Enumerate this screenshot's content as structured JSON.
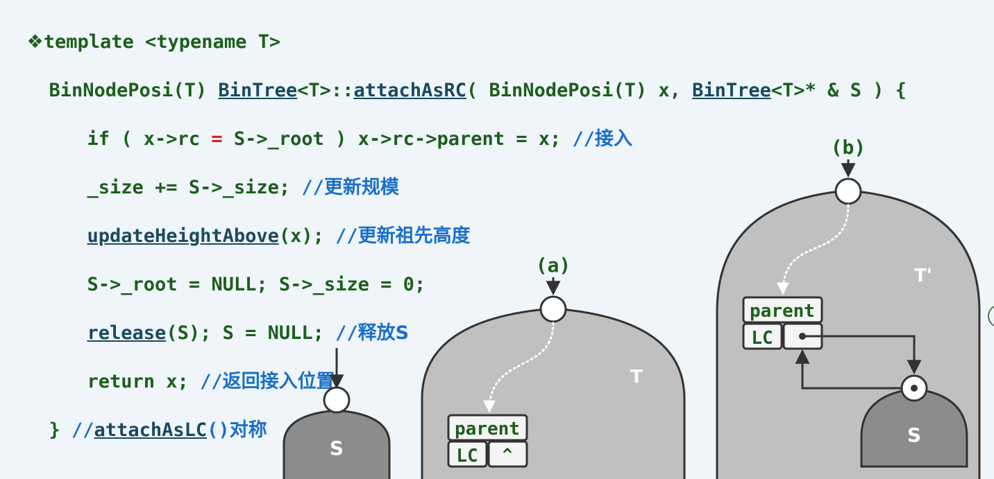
{
  "code": {
    "line1_bullet": "❖",
    "line1": "template <typename T>",
    "line2_a": "BinNodePosi(T) ",
    "line2_b": "BinTree",
    "line2_c": "<T>::",
    "line2_d": "attachAsRC",
    "line2_e": "( BinNodePosi(T) x, ",
    "line2_f": "BinTree",
    "line2_g": "<T>* & S ) {",
    "line3_a": "if ( x->rc ",
    "line3_eq": "=",
    "line3_b": " S->_root ) x->rc->parent = x; ",
    "line3_cm": "//",
    "line3_cn": "接入",
    "line4_a": "_size += S->_size; ",
    "line4_cm": "//",
    "line4_cn": "更新规模",
    "line5_a": "updateHeightAbove",
    "line5_b": "(x); ",
    "line5_cm": "//",
    "line5_cn": "更新祖先高度",
    "line6": "S->_root = NULL; S->_size = 0;",
    "line7_a": "release",
    "line7_b": "(S); S = NULL; ",
    "line7_cm": "//",
    "line7_cn": "释放S",
    "line8_a": "return x; ",
    "line8_cm": "//",
    "line8_cn": "返回接入位置",
    "line9_a": "} ",
    "line9_cm": "//",
    "line9_b": "attachAsLC",
    "line9_c": "()",
    "line9_cn": "对称"
  },
  "diagram": {
    "label_a": "(a)",
    "label_b": "(b)",
    "tree_T": "T",
    "tree_T_prime": "T'",
    "tree_S_left": "S",
    "tree_S_right": "S",
    "cell_parent_a": "parent",
    "cell_lc_a": "LC",
    "cell_null_a": "^",
    "cell_parent_b": "parent",
    "cell_lc_b": "LC"
  },
  "colors": {
    "background": "#f0f5fa",
    "code_green": "#1c5e1c",
    "comment_blue": "#1a70c8",
    "operator_red": "#e02020",
    "tree_light": "#c0c0c0",
    "tree_dark": "#8c8c8c",
    "outline": "#333333"
  }
}
